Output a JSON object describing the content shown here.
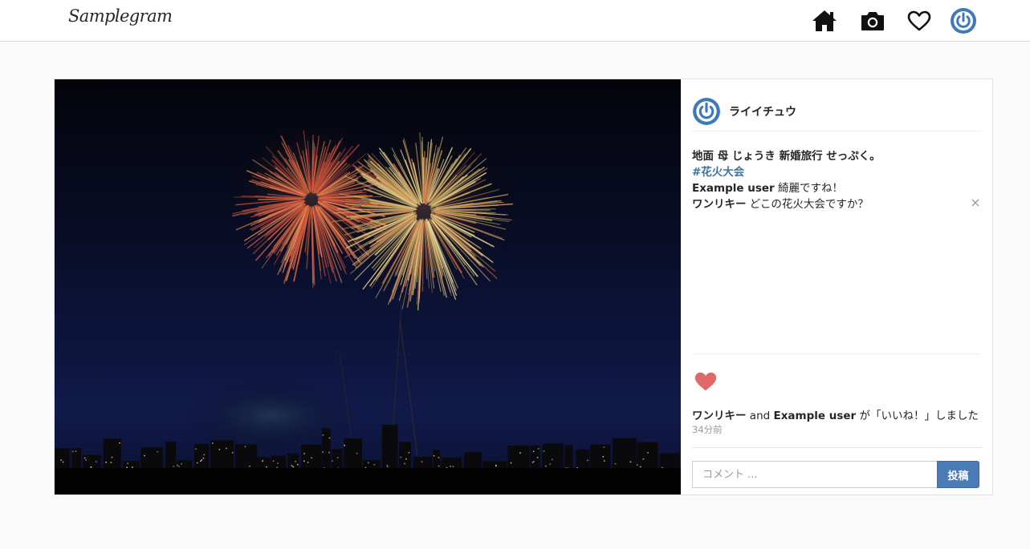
{
  "navbar": {
    "brand": "Samplegram",
    "icons": [
      "home-icon",
      "camera-icon",
      "heart-outline-icon",
      "power-avatar-icon"
    ]
  },
  "post": {
    "username": "ライイチュウ",
    "caption": "地面 母 じょうき 新婚旅行 せっぷく。",
    "hashtag": "#花火大会",
    "comments": [
      {
        "user": "Example user",
        "text": " 綺麗ですね！"
      },
      {
        "user": "ワンリキー",
        "text": " どこの花火大会ですか？"
      }
    ],
    "delete_symbol": "×",
    "likes": {
      "user1": "ワンリキー",
      "connector": " and ",
      "user2": "Example user",
      "suffix": " が「いいね！」しました"
    },
    "time_ago": "34分前",
    "comment_form": {
      "placeholder": "コメント ...",
      "submit_label": "投稿"
    }
  },
  "colors": {
    "accent": "#4a7bb7",
    "hashtag": "#3f729b",
    "like_heart": "#e06868",
    "avatar_ring": "#3f7ab8"
  }
}
